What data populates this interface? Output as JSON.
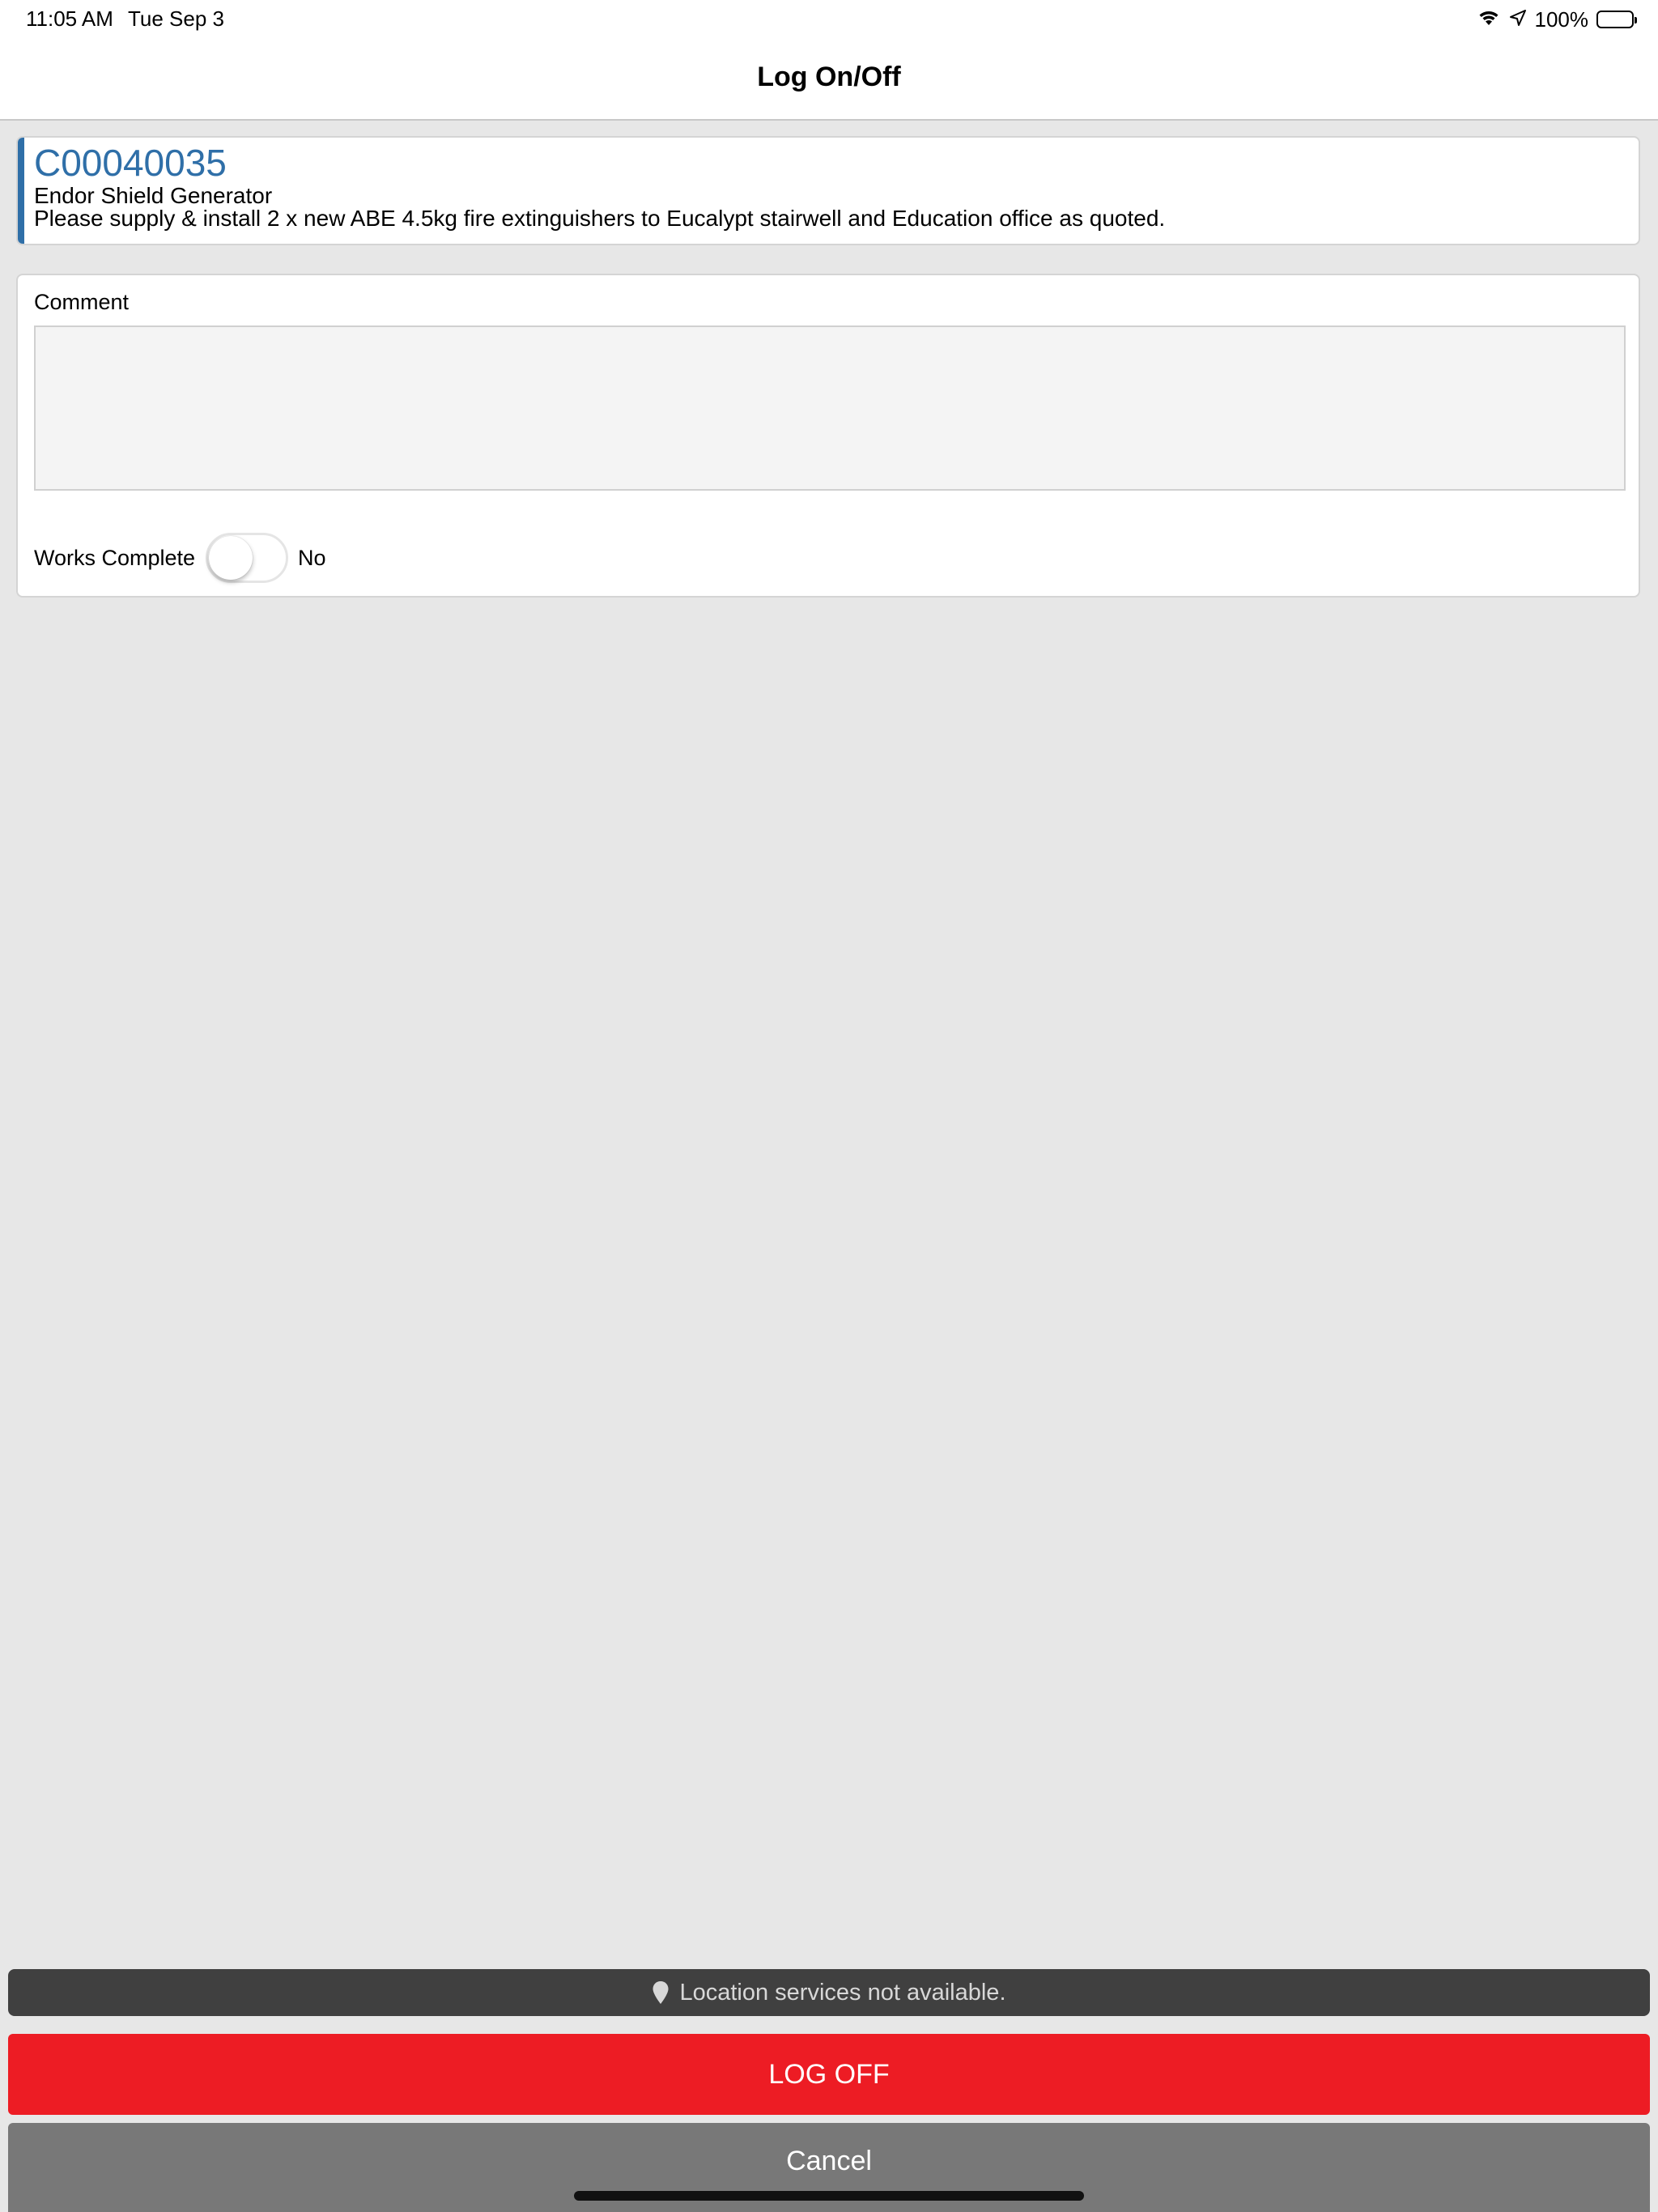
{
  "status_bar": {
    "time": "11:05 AM",
    "date": "Tue Sep 3",
    "battery": "100%",
    "icons": [
      "wifi-icon",
      "location-arrow-icon",
      "battery-icon"
    ]
  },
  "nav": {
    "title": "Log On/Off"
  },
  "job": {
    "code": "C00040035",
    "site": "Endor Shield Generator",
    "description": "Please  supply & install 2 x new ABE 4.5kg fire extinguishers to Eucalypt stairwell and Education office as quoted.",
    "accent_color": "#2f6fa8"
  },
  "form": {
    "comment_label": "Comment",
    "comment_value": "",
    "works_complete_label": "Works Complete",
    "works_complete_value": "No",
    "works_complete_on": false
  },
  "location_banner": {
    "text": "Location services not available.",
    "icon": "map-pin-icon"
  },
  "buttons": {
    "log_off": "LOG OFF",
    "log_off_color": "#ed1c24",
    "cancel": "Cancel",
    "cancel_color": "#787878"
  }
}
